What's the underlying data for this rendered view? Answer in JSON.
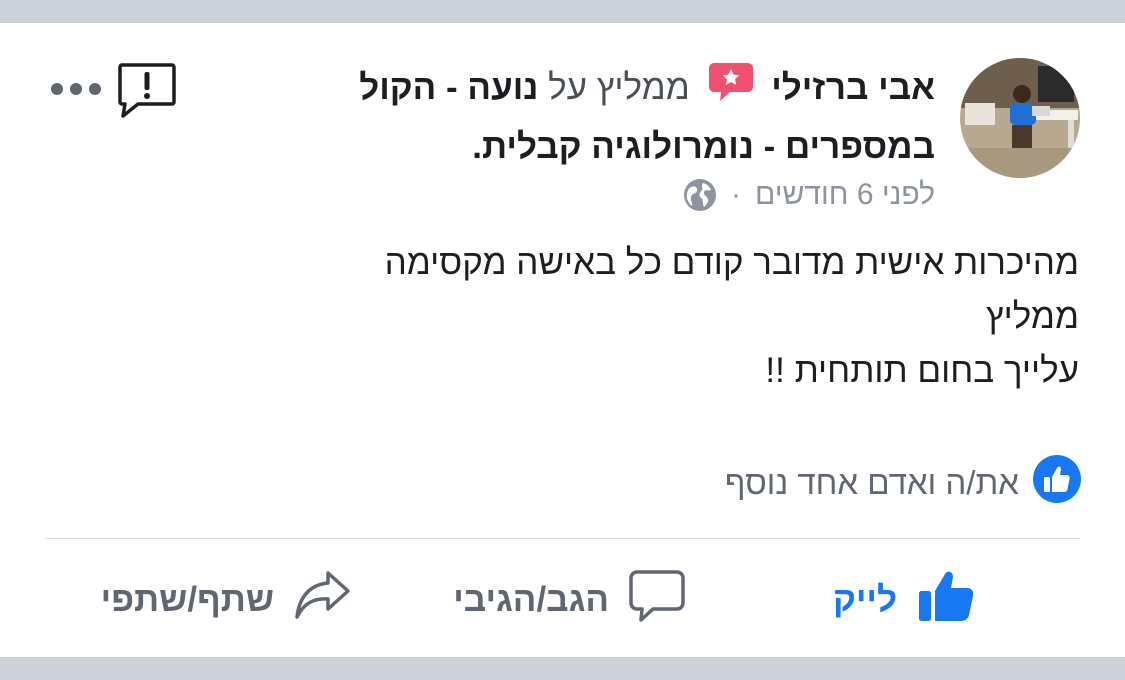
{
  "post": {
    "author_name": "אבי ברזילי",
    "verb": "ממליץ על",
    "page_name": "נועה - הקול במספרים - נומרולוגיה קבלית.",
    "timestamp": "לפני 6 חודשים",
    "separator": "·",
    "privacy_icon": "globe-icon",
    "body_lines": [
      "מהיכרות אישית מדובר קודם כל באישה מקסימה",
      "ממליץ",
      "עלייך בחום תותחית !!"
    ]
  },
  "reactions": {
    "text": "את/ה ואדם אחד נוסף",
    "icon": "like-reaction-icon"
  },
  "actions": {
    "like_label": "לייק",
    "comment_label": "הגב/הגיבי",
    "share_label": "שתף/שתפי"
  },
  "colors": {
    "accent": "#1877f2",
    "recommend_badge": "#f0506e",
    "muted": "#606770",
    "background": "#ccd0d8"
  }
}
